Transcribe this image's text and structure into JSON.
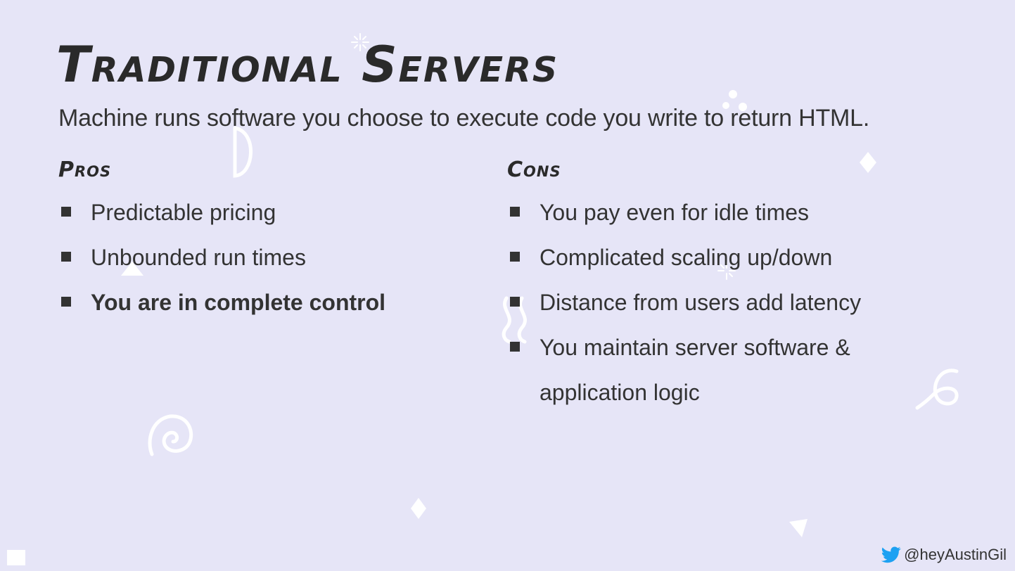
{
  "slide": {
    "title": "Traditional Servers",
    "subtitle": "Machine runs software you choose to execute code you write to return HTML.",
    "pros": {
      "heading": "Pros",
      "items": [
        "Predictable pricing",
        "Unbounded run times",
        "You are in complete control"
      ]
    },
    "cons": {
      "heading": "Cons",
      "items": [
        "You pay even for idle times",
        "Complicated scaling up/down",
        "Distance from users add latency",
        "You maintain server software & application logic"
      ]
    }
  },
  "footer": {
    "icon": "twitter-bird-icon",
    "handle": "@heyAustinGil"
  },
  "colors": {
    "background": "#e6e5f7",
    "text": "#333333",
    "twitter_blue": "#1da1f2"
  }
}
